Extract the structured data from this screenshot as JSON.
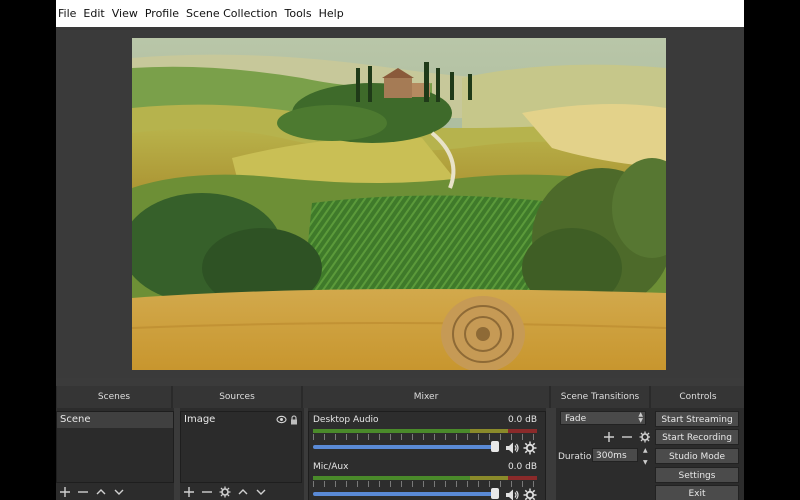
{
  "menu": [
    "File",
    "Edit",
    "View",
    "Profile",
    "Scene Collection",
    "Tools",
    "Help"
  ],
  "docks": {
    "scenes": "Scenes",
    "sources": "Sources",
    "mixer": "Mixer",
    "transitions": "Scene Transitions",
    "controls": "Controls"
  },
  "scenes": {
    "items": [
      "Scene"
    ]
  },
  "sources": {
    "items": [
      "Image"
    ]
  },
  "mixer": {
    "channels": [
      {
        "name": "Desktop Audio",
        "db": "0.0 dB"
      },
      {
        "name": "Mic/Aux",
        "db": "0.0 dB"
      }
    ]
  },
  "transitions": {
    "selected": "Fade",
    "duration_label": "Duration",
    "duration_value": "300ms"
  },
  "controls": [
    "Start Streaming",
    "Start Recording",
    "Studio Mode",
    "Settings",
    "Exit"
  ],
  "colors": {
    "background": "#3b3b3b",
    "accent_blue": "#5a8ad6",
    "meter_green": "#4a8a2a"
  }
}
